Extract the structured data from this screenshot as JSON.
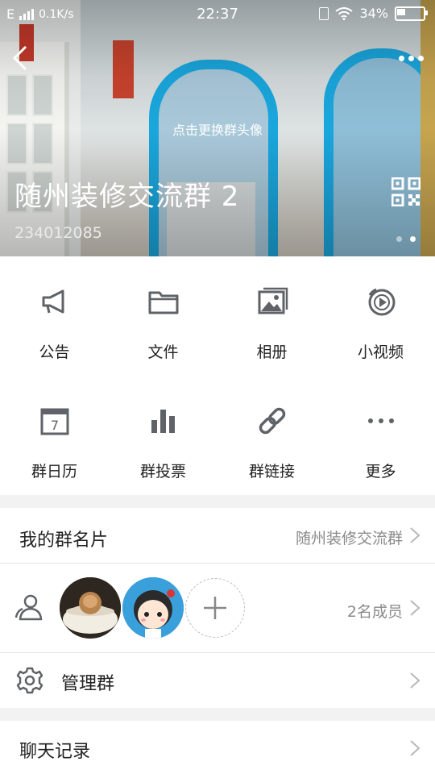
{
  "status_bar": {
    "network": "E",
    "speed": "0.1K/s",
    "time": "22:37",
    "battery": "34%",
    "battery_level": 0.34
  },
  "header": {
    "change_avatar_hint": "点击更换群头像",
    "group_name": "随州装修交流群 2",
    "group_id": "234012085",
    "page_dots": 2,
    "active_dot": 1
  },
  "functions": [
    {
      "label": "公告",
      "icon": "megaphone-icon"
    },
    {
      "label": "文件",
      "icon": "folder-icon"
    },
    {
      "label": "相册",
      "icon": "photo-album-icon"
    },
    {
      "label": "小视频",
      "icon": "video-icon"
    },
    {
      "label": "群日历",
      "icon": "calendar-icon",
      "calendar_day": "7"
    },
    {
      "label": "群投票",
      "icon": "bar-chart-icon"
    },
    {
      "label": "群链接",
      "icon": "link-icon"
    },
    {
      "label": "更多",
      "icon": "more-dots-icon"
    }
  ],
  "card": {
    "title": "我的群名片",
    "value": "随州装修交流群"
  },
  "members": {
    "count_label": "2名成员",
    "add_symbol": "+"
  },
  "manage": {
    "title": "管理群"
  },
  "chat_history": {
    "title": "聊天记录"
  },
  "colors": {
    "icon_gray": "#5f6368",
    "accent_blue": "#1aa7de",
    "text_primary": "#222222",
    "text_secondary": "#8a8a8a"
  }
}
